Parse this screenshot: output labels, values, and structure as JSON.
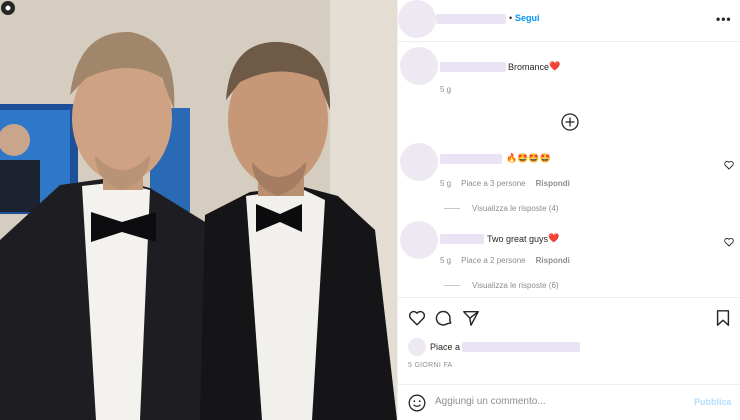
{
  "header": {
    "separator": "•",
    "follow_label": "Segui",
    "more_label": "•••"
  },
  "comments": [
    {
      "text": "Bromance",
      "emoji": "❤️",
      "time": "5 g"
    },
    {
      "text": "",
      "emoji": "🔥🤩🤩🤩",
      "time": "5 g",
      "likes": "Piace a 3 persone",
      "reply": "Rispondi",
      "view_replies": "Visualizza le risposte (4)"
    },
    {
      "text": "Two great guys",
      "emoji": "❤️",
      "time": "5 g",
      "likes": "Piace a 2 persone",
      "reply": "Rispondi",
      "view_replies": "Visualizza le risposte (6)"
    }
  ],
  "likes": {
    "prefix": "Piace a"
  },
  "date": "5 GIORNI FA",
  "add_comment": {
    "placeholder": "Aggiungi un commento...",
    "publish_label": "Pubblica"
  },
  "icons": {
    "header_more": "more-icon",
    "add_comment": "plus-circle-icon",
    "like": "heart-icon",
    "comment": "comment-icon",
    "share": "send-icon",
    "save": "bookmark-icon",
    "emoji": "emoji-icon",
    "comment_like": "heart-small-icon"
  },
  "colors": {
    "accent": "#0095f6",
    "publish_disabled": "#b2dffc",
    "muted": "#8e8e8e",
    "border": "#efefef",
    "text": "#262626"
  }
}
